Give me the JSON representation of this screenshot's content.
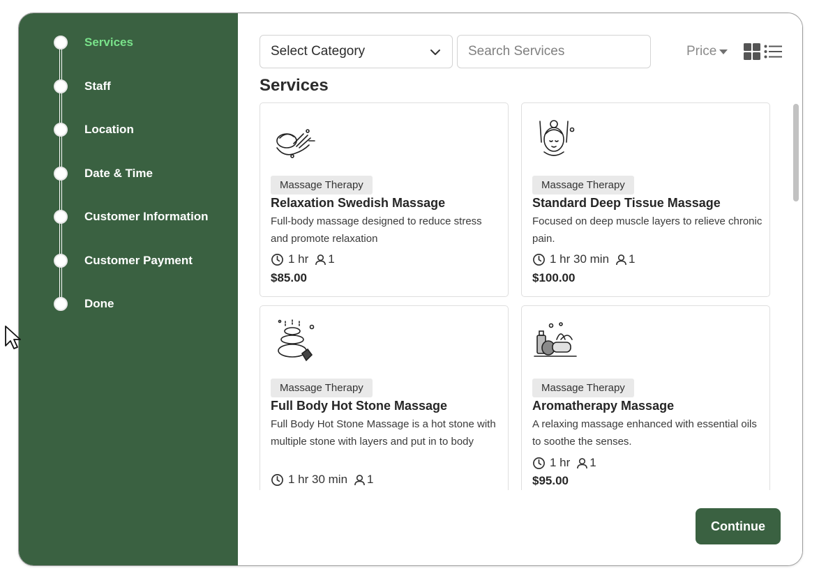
{
  "steps": [
    {
      "label": "Services",
      "active": true
    },
    {
      "label": "Staff"
    },
    {
      "label": "Location"
    },
    {
      "label": "Date & Time"
    },
    {
      "label": "Customer Information"
    },
    {
      "label": "Customer Payment"
    },
    {
      "label": "Done"
    }
  ],
  "toolbar": {
    "category_select": "Select Category",
    "search_placeholder": "Search Services",
    "sort_label": "Price"
  },
  "section_title": "Services",
  "services": [
    {
      "category": "Massage Therapy",
      "name": "Relaxation Swedish Massage",
      "description": "Full-body massage designed to reduce stress and promote relaxation",
      "duration": "1 hr",
      "capacity": "1",
      "price": "$85.00",
      "icon": "massage-hands-icon"
    },
    {
      "category": "Massage Therapy",
      "name": "Standard Deep Tissue Massage",
      "description": "Focused on deep muscle layers to relieve chronic pain.",
      "duration": "1 hr 30 min",
      "capacity": "1",
      "price": "$100.00",
      "icon": "face-massage-icon"
    },
    {
      "category": "Massage Therapy",
      "name": "Full Body Hot Stone Massage",
      "description": "Full Body Hot Stone Massage is a hot stone with multiple stone with layers and put in to body",
      "duration": "1 hr 30 min",
      "capacity": "1",
      "price": "",
      "icon": "hot-stones-icon"
    },
    {
      "category": "Massage Therapy",
      "name": "Aromatherapy Massage",
      "description": "A relaxing massage enhanced with essential oils to soothe the senses.",
      "duration": "1 hr",
      "capacity": "1",
      "price": "$95.00",
      "icon": "aroma-oils-icon"
    }
  ],
  "continue_label": "Continue",
  "colors": {
    "sidebar": "#3a6141",
    "active_step": "#79e28a",
    "button": "#3a6141"
  }
}
